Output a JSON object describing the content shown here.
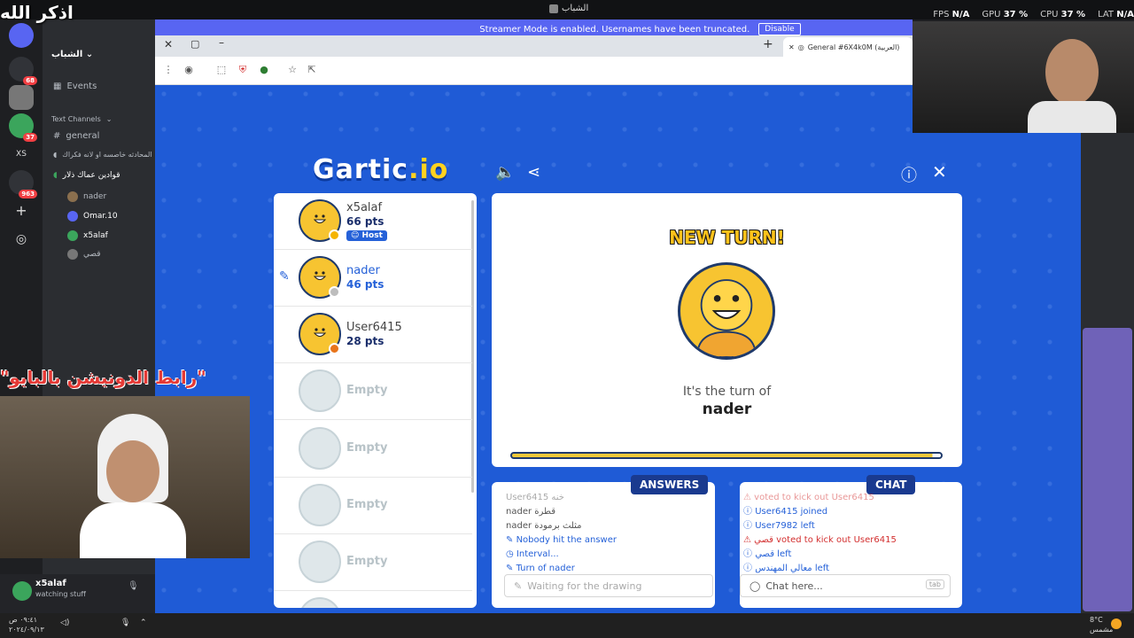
{
  "overlay": {
    "top_text": "اذكر الله",
    "banner_text": "\"رابط الدونيشن بالبايو\""
  },
  "os": {
    "window_title": "الشباب",
    "stats": [
      {
        "label": "FPS",
        "value": "N/A"
      },
      {
        "label": "GPU",
        "value": "37 %"
      },
      {
        "label": "CPU",
        "value": "37 %"
      },
      {
        "label": "LAT",
        "value": "N/A"
      }
    ]
  },
  "discord": {
    "server_name": "الشباب",
    "events_label": "Events",
    "category_label": "Text Channels",
    "channels": [
      {
        "label": "general"
      },
      {
        "label": "المحادثه خاصسه او لانه فكراك"
      },
      {
        "label": "قوادين عماك ذلار"
      }
    ],
    "voice_users": [
      {
        "name": "nader"
      },
      {
        "name": "Omar.10"
      },
      {
        "name": "x5alaf"
      },
      {
        "name": "قصي"
      }
    ],
    "badges": [
      "68",
      "37",
      "963"
    ],
    "rail_label": "XS",
    "user": {
      "name": "x5alaf",
      "status": "watching stuff"
    }
  },
  "streamer_bar": {
    "text": "Streamer Mode is enabled. Usernames have been truncated.",
    "button": "Disable"
  },
  "browser": {
    "tab_title": "General #6X4k0M (العربية)"
  },
  "game": {
    "logo_text": "Gartic",
    "logo_suffix": ".io",
    "players": [
      {
        "name": "x5alaf",
        "points": "66 pts",
        "host_label": "Host",
        "status_color": "#f5b400"
      },
      {
        "name": "nader",
        "points": "46 pts",
        "status_color": "#bdbdbd"
      },
      {
        "name": "User6415",
        "points": "28 pts",
        "status_color": "#e8741b"
      }
    ],
    "empty_label": "Empty",
    "new_turn": "NEW TURN!",
    "turn_of": "It's the turn of",
    "turn_name": "nader",
    "timer_progress": 0.98,
    "answers_tab": "ANSWERS",
    "chat_tab": "CHAT",
    "answers": [
      {
        "text": "User6415 خنه",
        "kind": "user"
      },
      {
        "text": "nader قطرة",
        "kind": "user"
      },
      {
        "text": "nader مثلث برمودة",
        "kind": "user"
      },
      {
        "text": "Nobody hit the answer",
        "kind": "sys"
      },
      {
        "text": "Interval...",
        "kind": "sys"
      },
      {
        "text": "Turn of nader",
        "kind": "sys"
      }
    ],
    "answer_placeholder": "Waiting for the drawing",
    "chat": [
      {
        "text": "voted to kick out User6415",
        "kind": "red"
      },
      {
        "text": "User6415 joined",
        "kind": "sys"
      },
      {
        "text": "User7982 left",
        "kind": "sys"
      },
      {
        "text": "قصي voted to kick out User6415",
        "kind": "red"
      },
      {
        "text": "قصي left",
        "kind": "sys"
      },
      {
        "text": "معالي المهندس left",
        "kind": "sys"
      }
    ],
    "chat_placeholder": "Chat here...",
    "chat_key": "tab"
  },
  "taskbar": {
    "time": "٠٩:٤١ ص",
    "date": "٢٠٢٤/٠٩/١٣",
    "weather": "8°C",
    "weather_desc": "مشمس"
  }
}
